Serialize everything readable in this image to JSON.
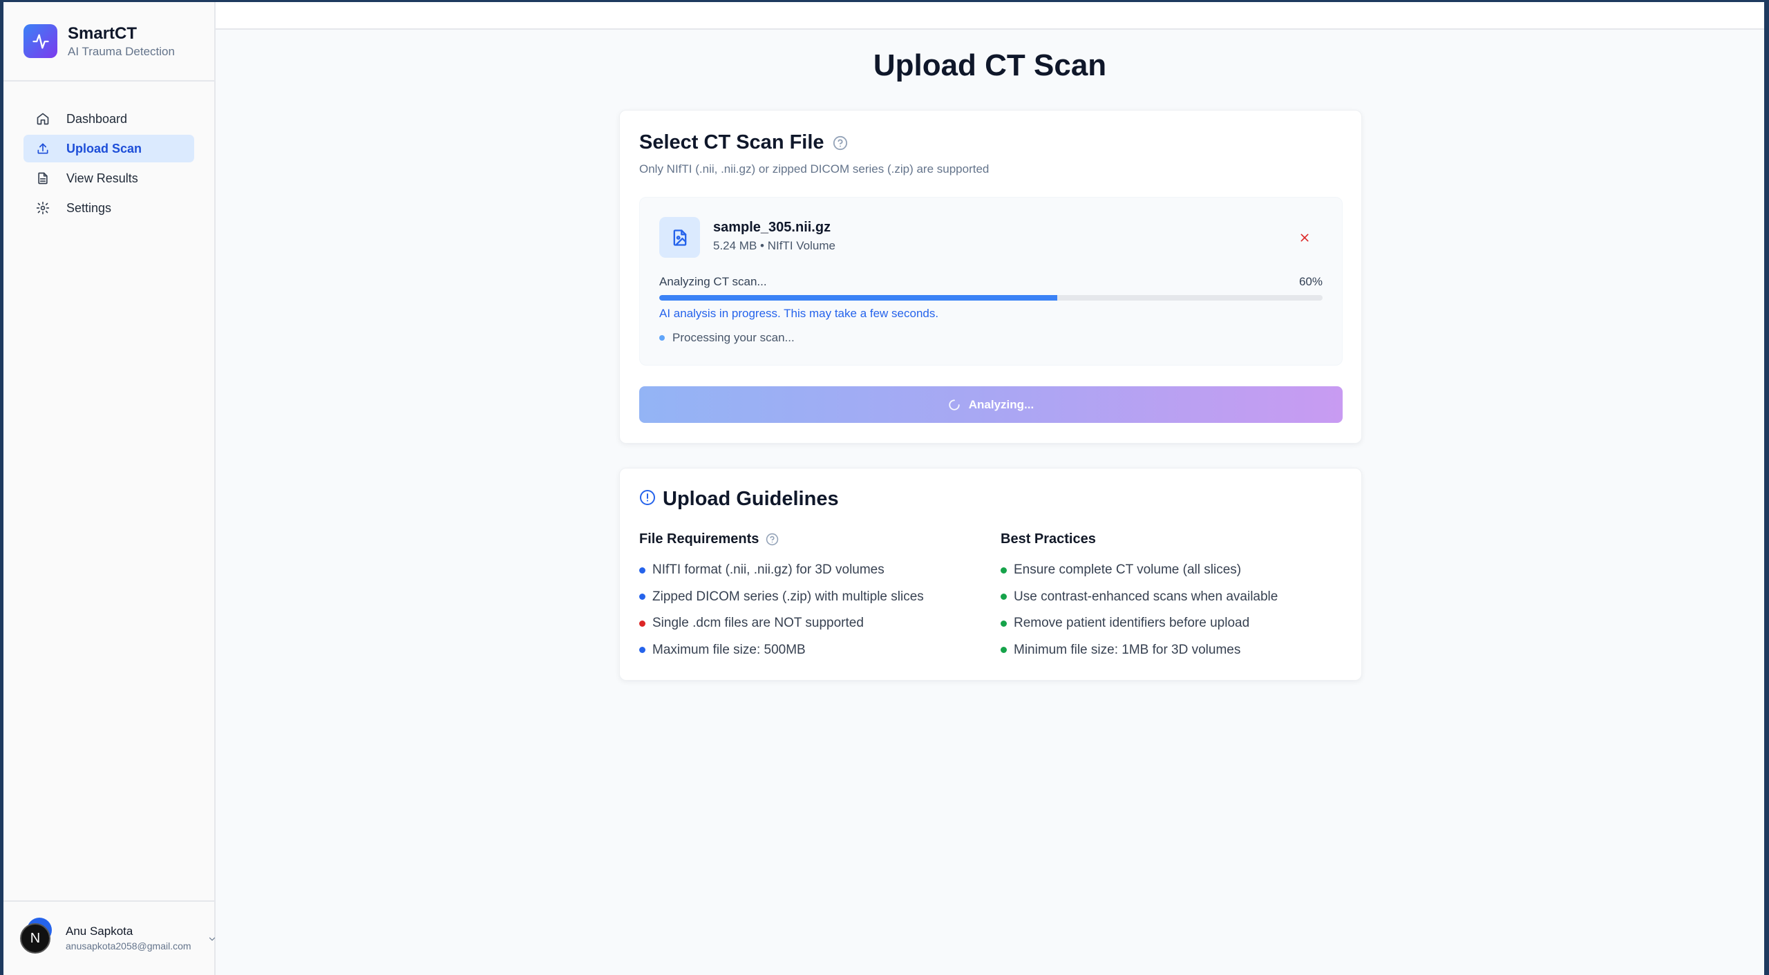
{
  "brand": {
    "title": "SmartCT",
    "subtitle": "AI Trauma Detection"
  },
  "nav": {
    "items": [
      {
        "label": "Dashboard",
        "icon": "home-icon"
      },
      {
        "label": "Upload Scan",
        "icon": "upload-icon",
        "active": true
      },
      {
        "label": "View Results",
        "icon": "file-text-icon"
      },
      {
        "label": "Settings",
        "icon": "gear-icon"
      }
    ]
  },
  "user": {
    "name": "Anu Sapkota",
    "email": "anusapkota2058@gmail.com",
    "badge": "N"
  },
  "page": {
    "title": "Upload CT Scan"
  },
  "upload": {
    "title": "Select CT Scan File",
    "subtitle": "Only NIfTI (.nii, .nii.gz) or zipped DICOM series (.zip) are supported",
    "file": {
      "name": "sample_305.nii.gz",
      "meta": "5.24 MB • NIfTI Volume"
    },
    "progress": {
      "label": "Analyzing CT scan...",
      "percent_text": "60%",
      "value": 0.6,
      "note": "AI analysis in progress. This may take a few seconds.",
      "status": "Processing your scan..."
    },
    "button_label": "Analyzing..."
  },
  "guidelines": {
    "title": "Upload Guidelines",
    "file_requirements": {
      "heading": "File Requirements",
      "items": [
        {
          "text": "NIfTI format (.nii, .nii.gz) for 3D volumes",
          "color": "#2563eb"
        },
        {
          "text": "Zipped DICOM series (.zip) with multiple slices",
          "color": "#2563eb"
        },
        {
          "text": "Single .dcm files are NOT supported",
          "color": "#dc2626"
        },
        {
          "text": "Maximum file size: 500MB",
          "color": "#2563eb"
        }
      ]
    },
    "best_practices": {
      "heading": "Best Practices",
      "items": [
        {
          "text": "Ensure complete CT volume (all slices)",
          "color": "#16a34a"
        },
        {
          "text": "Use contrast-enhanced scans when available",
          "color": "#16a34a"
        },
        {
          "text": "Remove patient identifiers before upload",
          "color": "#16a34a"
        },
        {
          "text": "Minimum file size: 1MB for 3D volumes",
          "color": "#16a34a"
        }
      ]
    }
  }
}
